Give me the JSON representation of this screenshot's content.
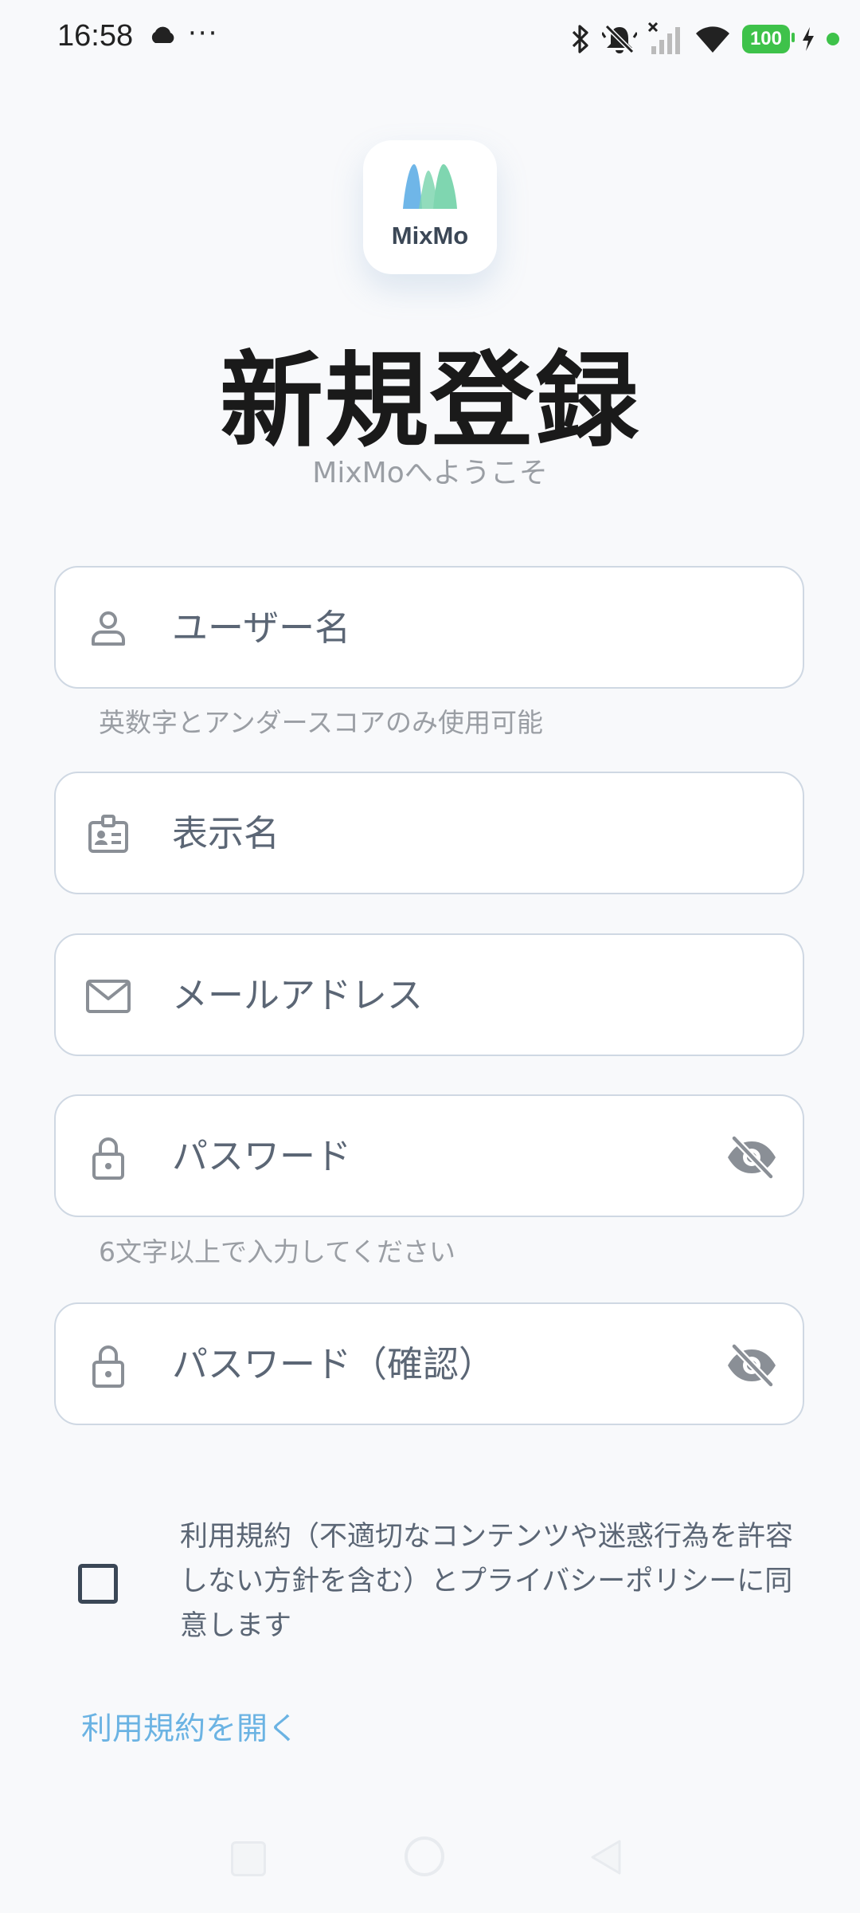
{
  "status_bar": {
    "time": "16:58",
    "more": "···",
    "battery": "100",
    "icons": [
      "cloud-icon",
      "bluetooth-icon",
      "bell-off-icon",
      "signal-off-icon",
      "wifi-icon",
      "battery-icon",
      "charging-icon",
      "status-dot"
    ]
  },
  "logo": {
    "text": "MixMo"
  },
  "header": {
    "title": "新規登録",
    "subtitle": "MixMoへようこそ"
  },
  "form": {
    "username": {
      "placeholder": "ユーザー名",
      "helper": "英数字とアンダースコアのみ使用可能",
      "icon": "user-icon"
    },
    "display_name": {
      "placeholder": "表示名",
      "icon": "id-badge-icon"
    },
    "email": {
      "placeholder": "メールアドレス",
      "icon": "mail-icon"
    },
    "password": {
      "placeholder": "パスワード",
      "helper": "6文字以上で入力してください",
      "icon": "lock-icon",
      "toggle_icon": "eye-off-icon"
    },
    "password_confirm": {
      "placeholder": "パスワード（確認）",
      "icon": "lock-icon",
      "toggle_icon": "eye-off-icon"
    }
  },
  "terms": {
    "checked": false,
    "text": "利用規約（不適切なコンテンツや迷惑行為を許容しない方針を含む）とプライバシーポリシーに同意します",
    "link": "利用規約を開く"
  },
  "colors": {
    "background": "#f8f9fb",
    "field_border": "#cfd8e3",
    "icon": "#8a8f96",
    "placeholder": "#5b6675",
    "link": "#6bb3e3",
    "logo_blue": "#6fb6e8",
    "logo_green": "#7fd6b0",
    "battery": "#3ec24a"
  }
}
